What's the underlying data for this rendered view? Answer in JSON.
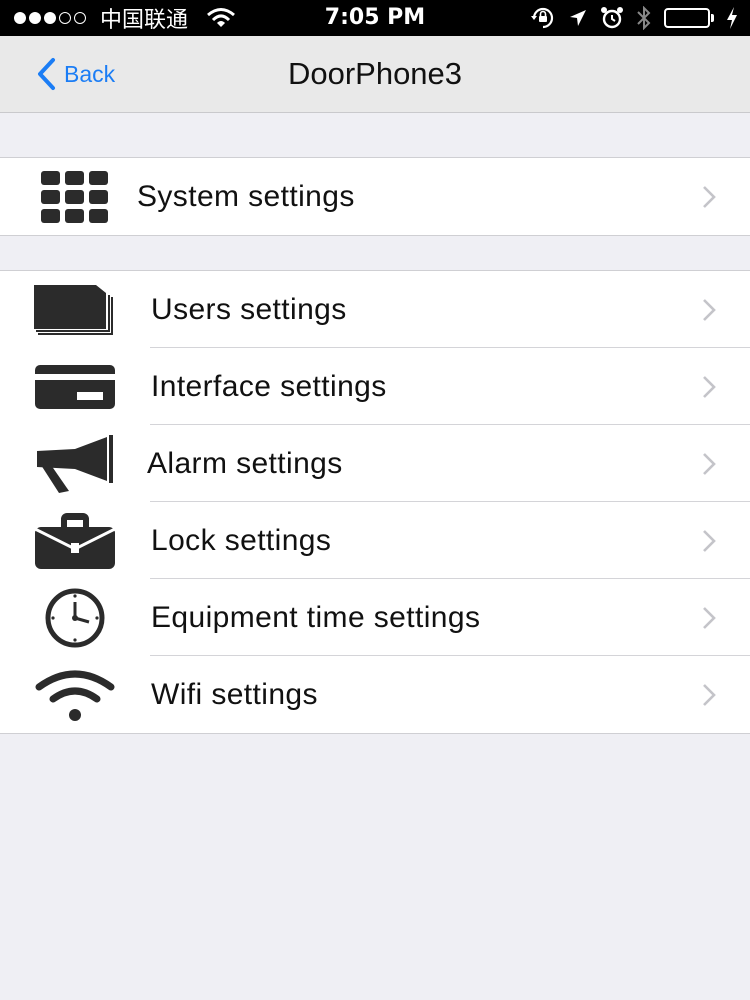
{
  "status_bar": {
    "signal": "●●●○○",
    "carrier": "中国联通",
    "time": "7:05 PM",
    "icons": [
      "wifi-icon",
      "orientation-lock-icon",
      "location-arrow-icon",
      "alarm-icon",
      "bluetooth-icon",
      "battery-icon",
      "charging-bolt-icon"
    ],
    "battery_color": "#4cd964"
  },
  "nav": {
    "back_label": "Back",
    "title": "DoorPhone3",
    "accent_color": "#1b7df5"
  },
  "groups": [
    {
      "items": [
        {
          "label": "System settings",
          "icon": "grid-icon"
        }
      ]
    },
    {
      "items": [
        {
          "label": "Users settings",
          "icon": "user-cards-icon"
        },
        {
          "label": "Interface settings",
          "icon": "card-icon"
        },
        {
          "label": "Alarm settings",
          "icon": "megaphone-icon"
        },
        {
          "label": "Lock settings",
          "icon": "lock-briefcase-icon"
        },
        {
          "label": "Equipment time settings",
          "icon": "clock-icon"
        },
        {
          "label": "Wifi settings",
          "icon": "wifi-icon"
        }
      ]
    }
  ]
}
